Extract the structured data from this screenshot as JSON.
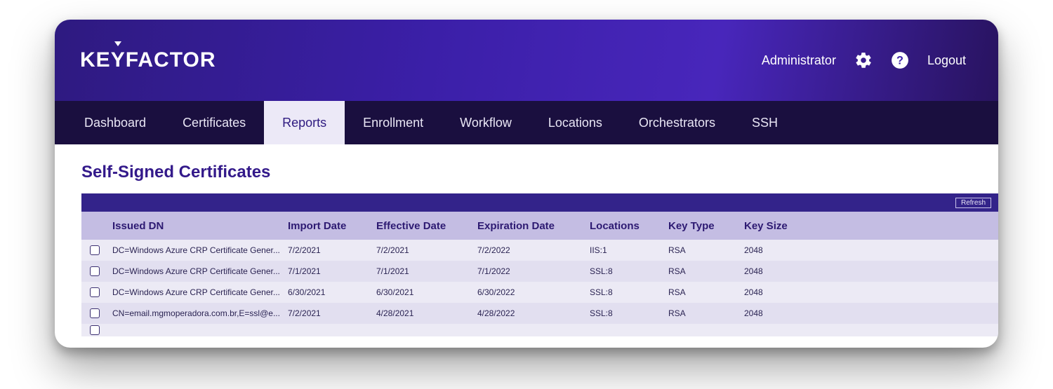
{
  "brand": {
    "text": "KEYFACTOR"
  },
  "header": {
    "user_label": "Administrator",
    "logout_label": "Logout"
  },
  "nav": {
    "items": [
      {
        "label": "Dashboard",
        "active": false
      },
      {
        "label": "Certificates",
        "active": false
      },
      {
        "label": "Reports",
        "active": true
      },
      {
        "label": "Enrollment",
        "active": false
      },
      {
        "label": "Workflow",
        "active": false
      },
      {
        "label": "Locations",
        "active": false
      },
      {
        "label": "Orchestrators",
        "active": false
      },
      {
        "label": "SSH",
        "active": false
      }
    ]
  },
  "page": {
    "title": "Self-Signed Certificates",
    "toolbar": {
      "refresh_label": "Refresh"
    },
    "columns": {
      "dn": "Issued DN",
      "imp": "Import Date",
      "eff": "Effective Date",
      "exp": "Expiration Date",
      "loc": "Locations",
      "kt": "Key Type",
      "ks": "Key Size"
    },
    "rows": [
      {
        "dn": "DC=Windows Azure CRP Certificate Gener...",
        "imp": "7/2/2021",
        "eff": "7/2/2021",
        "exp": "7/2/2022",
        "loc": "IIS:1",
        "kt": "RSA",
        "ks": "2048"
      },
      {
        "dn": "DC=Windows Azure CRP Certificate Gener...",
        "imp": "7/1/2021",
        "eff": "7/1/2021",
        "exp": "7/1/2022",
        "loc": "SSL:8",
        "kt": "RSA",
        "ks": "2048"
      },
      {
        "dn": "DC=Windows Azure CRP Certificate Gener...",
        "imp": "6/30/2021",
        "eff": "6/30/2021",
        "exp": "6/30/2022",
        "loc": "SSL:8",
        "kt": "RSA",
        "ks": "2048"
      },
      {
        "dn": "CN=email.mgmoperadora.com.br,E=ssl@e...",
        "imp": "7/2/2021",
        "eff": "4/28/2021",
        "exp": "4/28/2022",
        "loc": "SSL:8",
        "kt": "RSA",
        "ks": "2048"
      }
    ]
  }
}
